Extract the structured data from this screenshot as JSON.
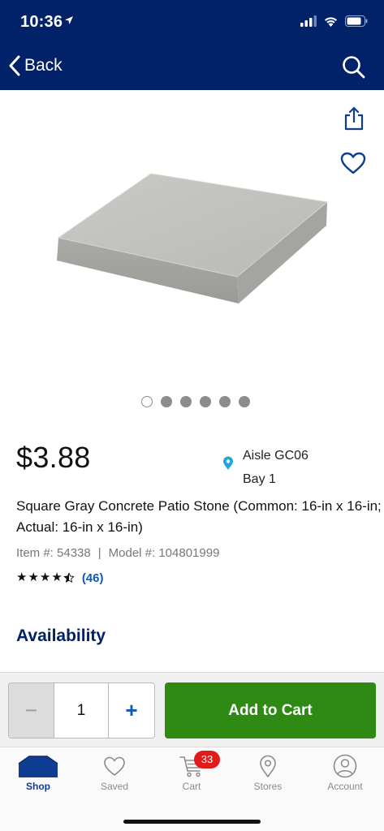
{
  "status": {
    "time": "10:36"
  },
  "nav": {
    "back_label": "Back"
  },
  "gallery": {
    "image_count": 6,
    "active_index": 0
  },
  "product": {
    "price": "$3.88",
    "aisle": "Aisle GC06",
    "bay": "Bay 1",
    "title": "Square Gray Concrete Patio Stone (Common: 16-in x 16-in; Actual: 16-in x 16-in)",
    "item_number": "Item #: 54338",
    "separator": "|",
    "model_number": "Model #: 104801999",
    "rating": 4.5,
    "review_count": "(46)"
  },
  "availability": {
    "heading": "Availability"
  },
  "cart": {
    "minus_label": "−",
    "quantity": "1",
    "plus_label": "+",
    "add_label": "Add to Cart"
  },
  "tabbar": {
    "items": [
      {
        "label": "Shop",
        "icon": "shop-icon",
        "active": true
      },
      {
        "label": "Saved",
        "icon": "heart-icon",
        "active": false
      },
      {
        "label": "Cart",
        "icon": "cart-icon",
        "active": false,
        "badge": "33"
      },
      {
        "label": "Stores",
        "icon": "location-pin-icon",
        "active": false
      },
      {
        "label": "Account",
        "icon": "account-icon",
        "active": false
      }
    ]
  },
  "colors": {
    "header_bg": "#012169",
    "accent_blue": "#0f5ab4",
    "add_to_cart_green": "#2e8a13",
    "badge_red": "#e21a1a"
  }
}
